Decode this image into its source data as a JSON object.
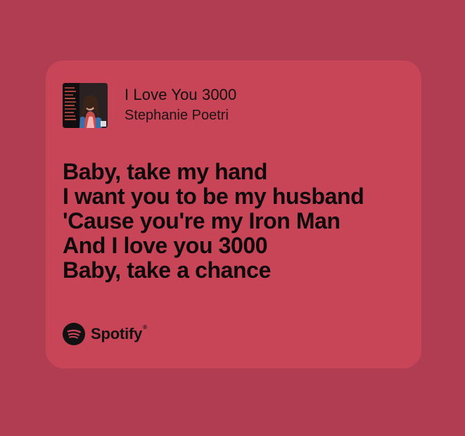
{
  "page": {
    "background_color": "#b03d52",
    "card_color": "#c84558",
    "text_color": "#111111"
  },
  "track": {
    "title": "I Love You 3000",
    "artist": "Stephanie Poetri",
    "cover_icon": "album-cover"
  },
  "lyrics": {
    "lines": [
      "Baby, take my hand",
      "I want you to be my husband",
      "'Cause you're my Iron Man",
      "And I love you 3000",
      "Baby, take a chance"
    ]
  },
  "brand": {
    "icon": "spotify-icon",
    "name": "Spotify",
    "mark": "®"
  }
}
